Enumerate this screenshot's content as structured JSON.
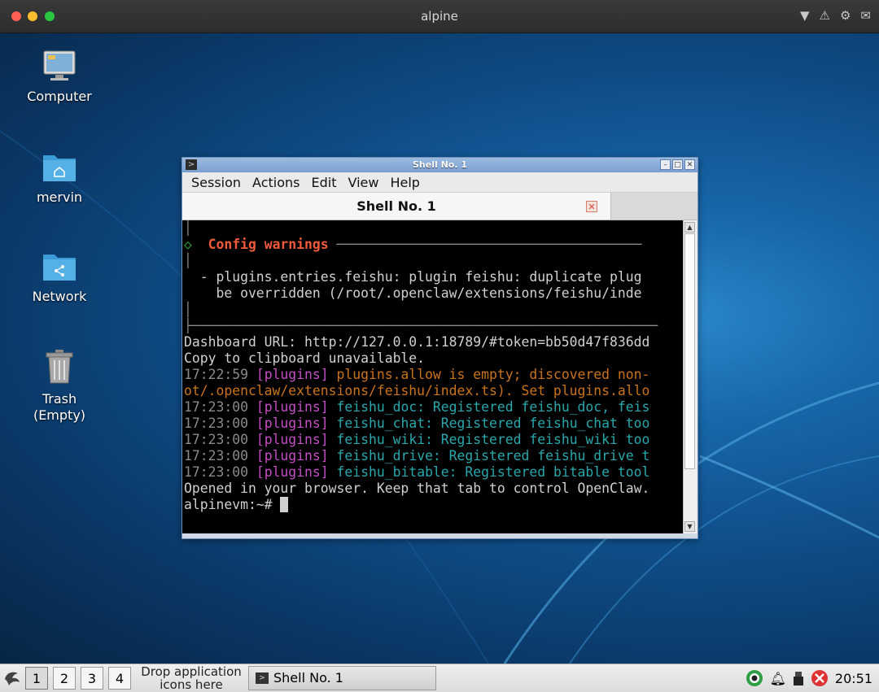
{
  "host": {
    "title": "alpine",
    "icons": [
      "dropdown-icon",
      "warning-icon",
      "gear-icon",
      "mail-icon"
    ]
  },
  "desktop": {
    "icons": [
      {
        "label": "Computer",
        "icon": "computer-icon"
      },
      {
        "label": "mervin",
        "icon": "home-folder-icon"
      },
      {
        "label": "Network",
        "icon": "network-folder-icon"
      },
      {
        "label": "Trash\n(Empty)",
        "icon": "trash-icon"
      }
    ]
  },
  "window": {
    "title": "Shell No. 1",
    "menu": [
      "Session",
      "Actions",
      "Edit",
      "View",
      "Help"
    ],
    "tab_label": "Shell No. 1"
  },
  "terminal": {
    "box_title": "Config warnings",
    "warning_1": "  - plugins.entries.feishu: plugin feishu: duplicate plug",
    "warning_2": "    be overridden (/root/.openclaw/extensions/feishu/inde",
    "dashboard": "Dashboard URL: http://127.0.0.1:18789/#token=bb50d47f836dd",
    "clipboard": "Copy to clipboard unavailable.",
    "log": [
      {
        "time": "17:22:59",
        "tag": "[plugins]",
        "msg": "plugins.allow is empty; discovered non-",
        "color": "orange"
      },
      {
        "time": "",
        "tag": "",
        "msg": "ot/.openclaw/extensions/feishu/index.ts). Set plugins.allo",
        "color": "orange"
      },
      {
        "time": "17:23:00",
        "tag": "[plugins]",
        "msg": "feishu_doc: Registered feishu_doc, feis",
        "color": "teal"
      },
      {
        "time": "17:23:00",
        "tag": "[plugins]",
        "msg": "feishu_chat: Registered feishu_chat too",
        "color": "teal"
      },
      {
        "time": "17:23:00",
        "tag": "[plugins]",
        "msg": "feishu_wiki: Registered feishu_wiki too",
        "color": "teal"
      },
      {
        "time": "17:23:00",
        "tag": "[plugins]",
        "msg": "feishu_drive: Registered feishu_drive t",
        "color": "teal"
      },
      {
        "time": "17:23:00",
        "tag": "[plugins]",
        "msg": "feishu_bitable: Registered bitable tool",
        "color": "teal"
      }
    ],
    "opened": "Opened in your browser. Keep that tab to control OpenClaw.",
    "prompt": "alpinevm:~# "
  },
  "taskbar": {
    "workspaces": [
      "1",
      "2",
      "3",
      "4"
    ],
    "active_workspace": "1",
    "drop_text": "Drop application icons here",
    "task_label": "Shell No. 1",
    "clock": "20:51"
  }
}
